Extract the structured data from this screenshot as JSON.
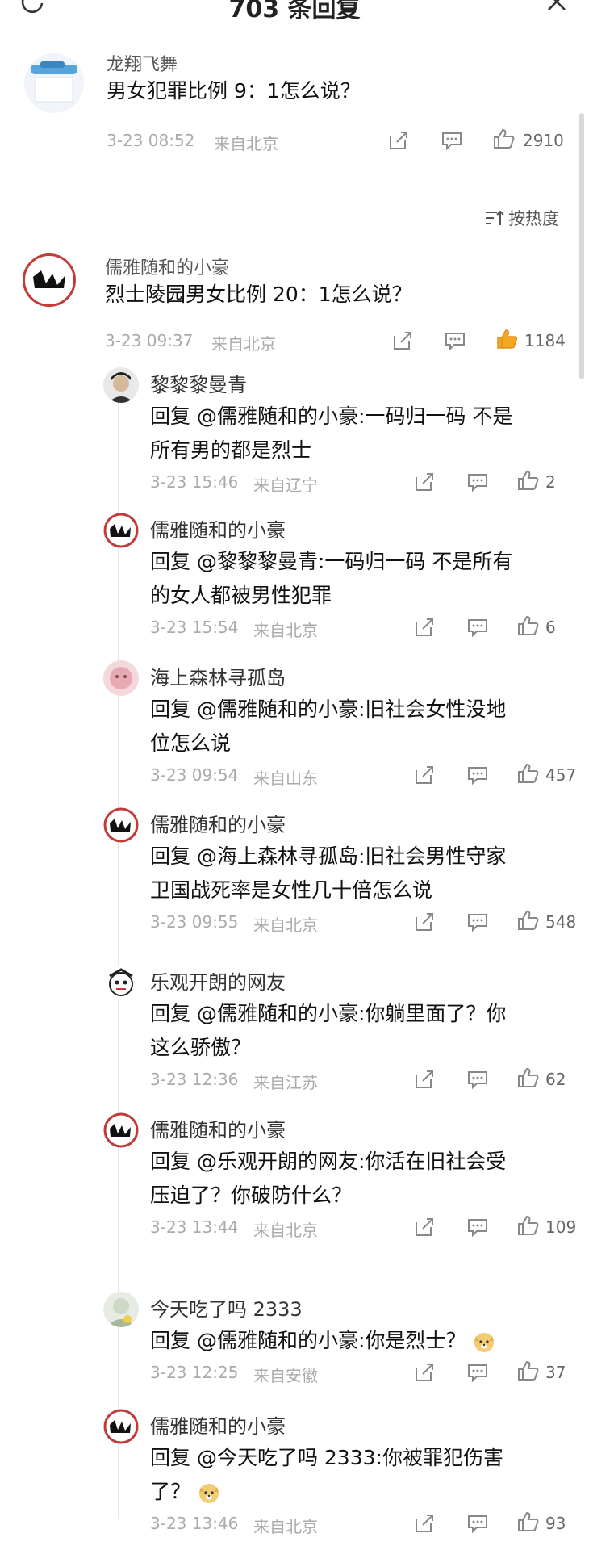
{
  "header": {
    "title": "703 条回复"
  },
  "main_comment": {
    "user": "龙翔飞舞",
    "text": "男女犯罪比例 9：1怎么说？",
    "time": "3-23 08:52",
    "location": "来自北京",
    "likes": "2910"
  },
  "sort": {
    "label": "按热度"
  },
  "top_reply": {
    "user": "儒雅随和的小豪",
    "text": "烈士陵园男女比例 20：1怎么说？",
    "time": "3-23 09:37",
    "location": "来自北京",
    "likes": "1184"
  },
  "replies": [
    {
      "user": "黎黎黎曼青",
      "line1": "回复 @儒雅随和的小豪:一码归一码  不是",
      "line2": "所有男的都是烈士",
      "time": "3-23 15:46",
      "location": "来自辽宁",
      "likes": "2"
    },
    {
      "user": "儒雅随和的小豪",
      "line1": "回复 @黎黎黎曼青:一码归一码  不是所有",
      "line2": "的女人都被男性犯罪",
      "time": "3-23 15:54",
      "location": "来自北京",
      "likes": "6"
    },
    {
      "user": "海上森林寻孤岛",
      "line1": "回复 @儒雅随和的小豪:旧社会女性没地",
      "line2": "位怎么说",
      "time": "3-23 09:54",
      "location": "来自山东",
      "likes": "457"
    },
    {
      "user": "儒雅随和的小豪",
      "line1": "回复 @海上森林寻孤岛:旧社会男性守家",
      "line2": "卫国战死率是女性几十倍怎么说",
      "time": "3-23 09:55",
      "location": "来自北京",
      "likes": "548"
    },
    {
      "user": "乐观开朗的网友",
      "line1": "回复 @儒雅随和的小豪:你躺里面了？你",
      "line2": "这么骄傲？",
      "time": "3-23 12:36",
      "location": "来自江苏",
      "likes": "62"
    },
    {
      "user": "儒雅随和的小豪",
      "line1": "回复 @乐观开朗的网友:你活在旧社会受",
      "line2": "压迫了？你破防什么？",
      "time": "3-23 13:44",
      "location": "来自北京",
      "likes": "109"
    },
    {
      "user": "今天吃了吗 2333",
      "line1": "回复 @儒雅随和的小豪:你是烈士？",
      "line2": "",
      "time": "3-23 12:25",
      "location": "来自安徽",
      "likes": "37"
    },
    {
      "user": "儒雅随和的小豪",
      "line1": "回复 @今天吃了吗 2333:你被罪犯伤害",
      "line2": "了？",
      "time": "3-23 13:46",
      "location": "来自北京",
      "likes": "93"
    }
  ],
  "colors": {
    "like_active": "#f5a623",
    "meta": "#aaaaaa",
    "icon": "#888888"
  }
}
